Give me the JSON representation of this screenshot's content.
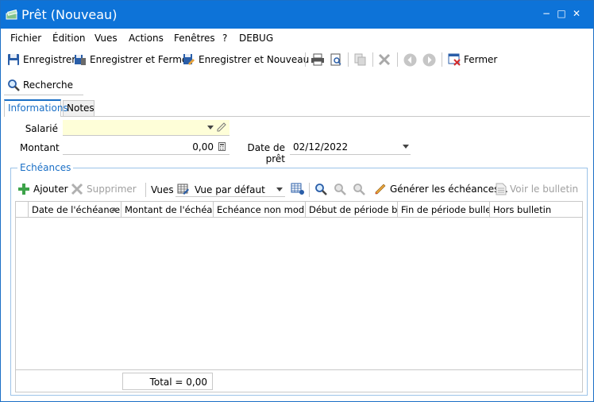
{
  "window": {
    "title": "Prêt (Nouveau)",
    "minimize": "−",
    "maximize": "□",
    "close": "✕"
  },
  "menu": [
    "Fichier",
    "Édition",
    "Vues",
    "Actions",
    "Fenêtres",
    "?",
    "DEBUG"
  ],
  "toolbar": {
    "save": "Enregistrer",
    "save_close": "Enregistrer et Fermer",
    "save_new": "Enregistrer et Nouveau",
    "close": "Fermer"
  },
  "search": {
    "label": "Recherche"
  },
  "tabs": [
    {
      "label": "Informations",
      "active": true
    },
    {
      "label": "Notes",
      "active": false
    }
  ],
  "form": {
    "employee_label": "Salarié",
    "employee_value": "",
    "amount_label": "Montant",
    "amount_value": "0,00",
    "loan_date_label": "Date de prêt",
    "loan_date_value": "02/12/2022"
  },
  "installments": {
    "title": "Echéances",
    "add": "Ajouter",
    "delete": "Supprimer",
    "views_label": "Vues",
    "view_selected": "Vue par défaut",
    "generate": "Générer les échéances...",
    "view_bulletin": "Voir le bulletin",
    "columns": [
      "Date de l'échéance",
      "Montant de l'échéance",
      "Echéance non modifi...",
      "Début de période bul...",
      "Fin de période bulletin",
      "Hors bulletin"
    ],
    "rows": [],
    "total": "Total = 0,00"
  },
  "colors": {
    "accent": "#0d73d8",
    "required_field": "#fefed8"
  }
}
